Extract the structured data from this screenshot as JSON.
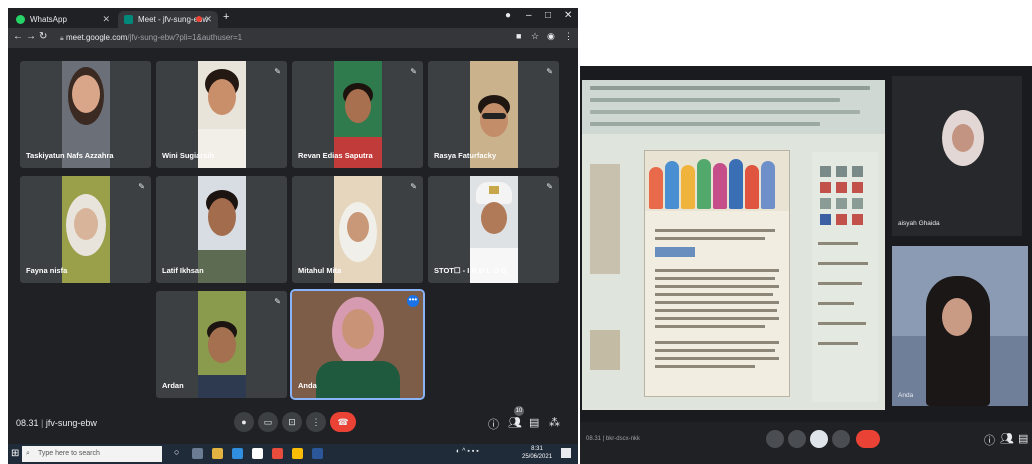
{
  "browser": {
    "tabs": [
      {
        "label": "WhatsApp",
        "fav_color": "#25d366"
      },
      {
        "label": "Meet - jfv-sung-ebw",
        "fav_color": "#00897b"
      }
    ],
    "new_tab": "+",
    "url_host": "meet.google.com",
    "url_path": "/jfv-sung-ebw?pli=1&authuser=1"
  },
  "participants": [
    {
      "name": "Taskiyatun Nafs Azzahra",
      "bg": "#6b6f77",
      "skin": "#d9a68a",
      "hair": "#3a2a22"
    },
    {
      "name": "Wini Sugiarsih",
      "bg": "#e9e4da",
      "skin": "#c98e6a",
      "hair": "#241812"
    },
    {
      "name": "Revan Edias Saputra",
      "bg": "#2f7b4e",
      "skin": "#a8704e",
      "hair": "#1d130e"
    },
    {
      "name": "Rasya Faturfacky",
      "bg": "#c9b28c",
      "skin": "#c38d6a",
      "hair": "#1f1611"
    },
    {
      "name": "Fayna nisfa",
      "bg": "#9aa04a",
      "skin": "#d8b59a",
      "hair": "#e8e4dc"
    },
    {
      "name": "Latif Ikhsan",
      "bg": "#d8dde3",
      "skin": "#a36d4d",
      "hair": "#1c1410"
    },
    {
      "name": "Mitahul Mita",
      "bg": "#e6d6be",
      "skin": "#c89878",
      "hair": "#f1efea"
    },
    {
      "name": "STOT☐ - I R U L O G",
      "bg": "#dfe2e4",
      "skin": "#b07a58",
      "hair": "#f4f4f4"
    },
    {
      "name": "Ardan",
      "bg": "#8a9b4e",
      "skin": "#a4704f",
      "hair": "#1b1410"
    },
    {
      "name": "Anda",
      "bg": "#7d5d48",
      "skin": "#c99377",
      "hair": "#d69bb0"
    }
  ],
  "meeting": {
    "time": "08.31",
    "separator": "|",
    "code": "jfv-sung-ebw",
    "people_count": "10"
  },
  "taskbar": {
    "search_placeholder": "Type here to search",
    "time": "8:31",
    "date": "25/06/2021"
  },
  "right_photo": {
    "tile_top_name": "aisyah Ghaida",
    "tile_bottom_name": "Anda",
    "meet_info": "08.31 | bkr-dscx-nkk"
  },
  "colors": {
    "meet_bg": "#202124",
    "tile_bg": "#3c4043",
    "end_call": "#ea4335",
    "active_outline": "#8ab4f8"
  }
}
